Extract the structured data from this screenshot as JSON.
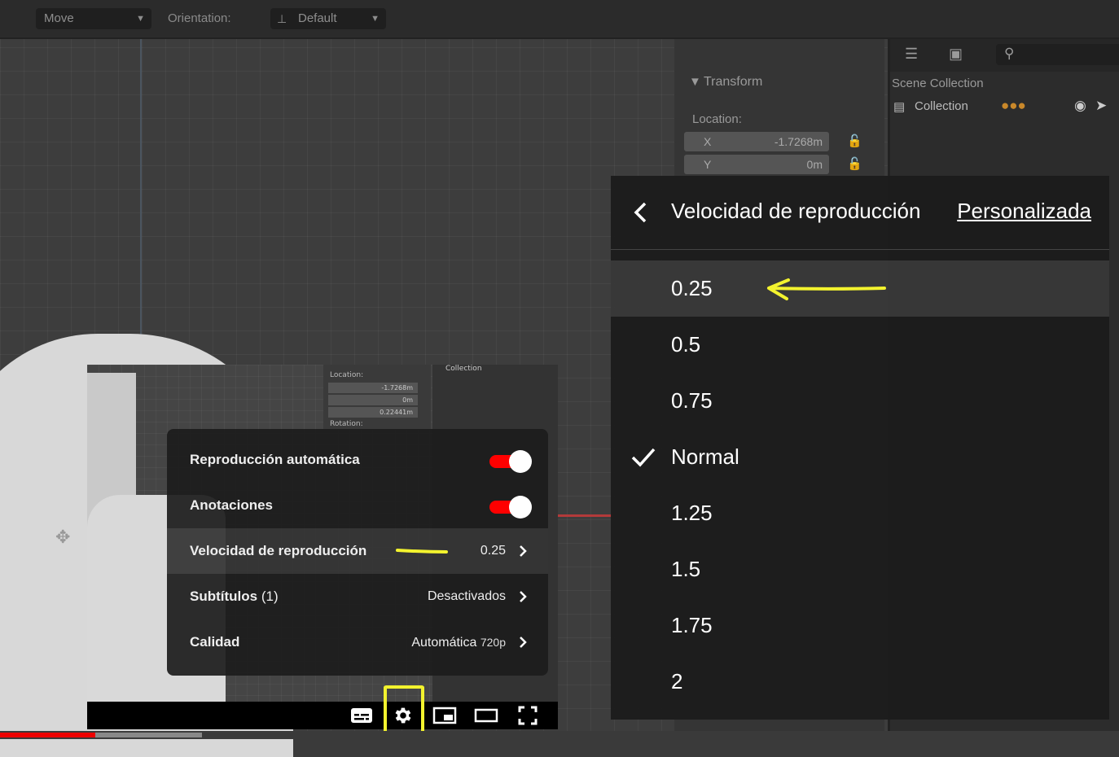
{
  "blender": {
    "tool_dropdown": "Move",
    "orientation_label": "Orientation:",
    "orientation_value": "Default",
    "transform_header": "Transform",
    "location_label": "Location:",
    "loc_x_label": "X",
    "loc_x_value": "-1.7268m",
    "loc_y_label": "Y",
    "loc_y_value": "0m",
    "scene_collection": "Scene Collection",
    "collection": "Collection"
  },
  "video_overlay": {
    "mini_collection": "Collection",
    "mini_location": "Location:",
    "mini_x": "-1.7268m",
    "mini_y": "0m",
    "mini_z": "0.22441m",
    "mini_rotation": "Rotation:"
  },
  "settings_menu": {
    "rows": [
      {
        "label": "Reproducción automática",
        "toggle": true
      },
      {
        "label": "Anotaciones",
        "toggle": true
      },
      {
        "label": "Velocidad de reproducción",
        "value": "0.25"
      },
      {
        "label": "Subtítulos",
        "sub": "(1)",
        "value": "Desactivados"
      },
      {
        "label": "Calidad",
        "value": "Automática",
        "value_small": "720p"
      }
    ]
  },
  "speed_panel": {
    "title": "Velocidad de reproducción",
    "custom": "Personalizada",
    "options": [
      "0.25",
      "0.5",
      "0.75",
      "Normal",
      "1.25",
      "1.5",
      "1.75",
      "2"
    ],
    "selected": "Normal",
    "highlighted": "0.25"
  },
  "controls": {
    "icons": [
      "subtitles-icon",
      "settings-icon",
      "miniplayer-icon",
      "theater-icon",
      "fullscreen-icon"
    ]
  },
  "progress": {
    "played_fraction": 0.085,
    "buffered_fraction": 0.18
  },
  "colors": {
    "annotation": "#f3f32e",
    "accent": "#ff0000"
  }
}
